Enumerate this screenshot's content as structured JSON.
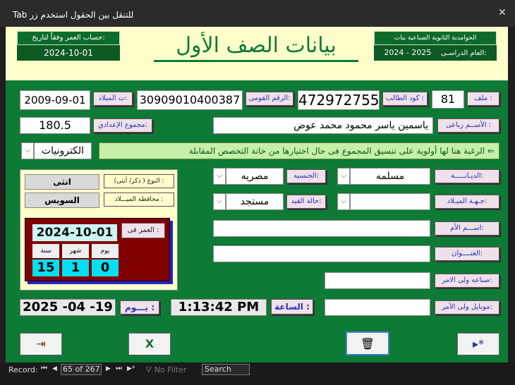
{
  "window": {
    "title": "Tab  للتنقل بين الحقول استخدم زر",
    "close_glyph": "✕"
  },
  "header": {
    "age_calc_label": "حساب العمر    وفقاً لتاريخ:",
    "age_calc_date": "2024-10-01",
    "main_title": "بيانات الصف الأول",
    "school_name": "الحوامدية الثانوية الصناعية بنات",
    "academic_year_label": "العام الدراسـى:",
    "academic_year": "2024 - 2025"
  },
  "form": {
    "file_label": "ملف :",
    "file_value": "81",
    "student_code_label": "كود الطالب :",
    "student_code_value": "472972755",
    "national_id_label": "الرقم القومى:",
    "national_id_value": "30909010400387",
    "birth_date_label": "ت الميلاد:",
    "birth_date_value": "2009-09-01",
    "full_name_label": "الأســم رباعى :",
    "full_name_value": "ياسمين ياسر محمود محمد عوض",
    "prep_total_label": "مجموع الإعدادي:",
    "prep_total_value": "180.5",
    "desire_banner": "الرغبة هنا لها أولوية على تنسيق المجموع فى حال اختيارها من خانة التخصص المقابلة ⇐",
    "desire_value": "الكترونيات",
    "religion_label": "الديـانـــــة:",
    "religion_value": "مسلمه",
    "nationality_label": "الجنسيه:",
    "nationality_value": "مصريه",
    "birth_place_label": "جـهـة الميـلاد:",
    "birth_place_value": "",
    "enroll_status_label": "حالة القيد:",
    "enroll_status_value": "مستجد",
    "mother_name_label": "اســـم الأم:",
    "mother_name_value": "",
    "address_label": "العنــــوان:",
    "address_value": "",
    "guardian_job_label": "صناعه ولى الامر:",
    "guardian_job_value": "",
    "guardian_mobile_label": "موبايل ولى الأمر:",
    "guardian_mobile_value": "",
    "time_label": "الساعة :",
    "time_value": "1:13:42 PM",
    "day_label": "يـــوم :",
    "day_value": "2025 -04 -19"
  },
  "info_panel": {
    "gender_label": "النوع ( ذكر/ أنثى) :",
    "gender_value": "انثى",
    "birth_gov_label": "محافظة الميـــلاد :",
    "birth_gov_value": "السويس",
    "age_at_label": "العمر  فى :",
    "age_at_date": "2024-10-01",
    "day_head": "يوم",
    "month_head": "شهر",
    "year_head": "سنة",
    "age_days": "0",
    "age_months": "1",
    "age_years": "15"
  },
  "buttons": {
    "new_record": "▸*",
    "delete_record": "🗑",
    "excel": "X",
    "exit": "⇥"
  },
  "statusbar": {
    "record_label": "Record:",
    "first": "⏮",
    "prev": "◀",
    "current": "65 of 267",
    "next": "▶",
    "last": "⏭",
    "new": "▶*",
    "filter": "No Filter",
    "search": "Search"
  }
}
